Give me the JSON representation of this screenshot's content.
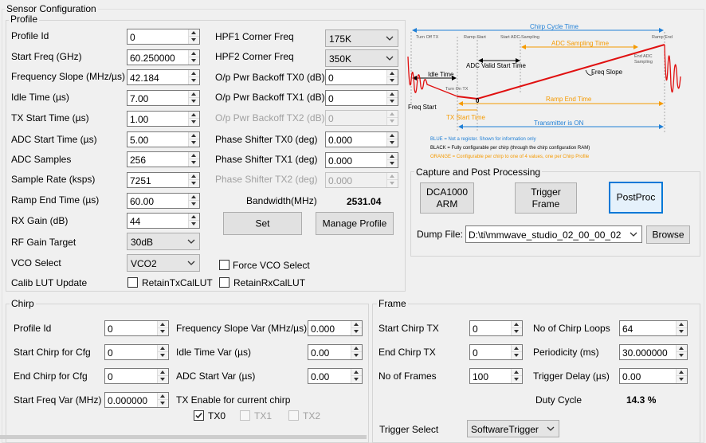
{
  "sensor_config": {
    "title": "Sensor Configuration"
  },
  "profile": {
    "title": "Profile",
    "fields": [
      {
        "label": "Profile Id",
        "value": "0"
      },
      {
        "label": "Start Freq (GHz)",
        "value": "60.250000"
      },
      {
        "label": "Frequency Slope (MHz/µs)",
        "value": "42.184"
      },
      {
        "label": "Idle Time (µs)",
        "value": "7.00"
      },
      {
        "label": "TX Start Time (µs)",
        "value": "1.00"
      },
      {
        "label": "ADC Start Time (µs)",
        "value": "5.00"
      },
      {
        "label": "ADC Samples",
        "value": "256"
      },
      {
        "label": "Sample Rate (ksps)",
        "value": "7251"
      },
      {
        "label": "Ramp End Time (µs)",
        "value": "60.00"
      },
      {
        "label": "RX Gain (dB)",
        "value": "44"
      }
    ],
    "rf_gain_target": {
      "label": "RF Gain Target",
      "value": "30dB"
    },
    "vco_select": {
      "label": "VCO Select",
      "value": "VCO2"
    },
    "calib_lut": {
      "label": "Calib LUT Update",
      "tx_label": "RetainTxCalLUT",
      "rx_label": "RetainRxCalLUT"
    },
    "hpf1": {
      "label": "HPF1 Corner Freq",
      "value": "175K"
    },
    "hpf2": {
      "label": "HPF2 Corner Freq",
      "value": "350K"
    },
    "right_fields": [
      {
        "label": "O/p Pwr Backoff TX0 (dB)",
        "value": "0"
      },
      {
        "label": "O/p Pwr Backoff TX1 (dB)",
        "value": "0"
      },
      {
        "label": "O/p Pwr Backoff TX2 (dB)",
        "value": "0"
      },
      {
        "label": "Phase Shifter TX0 (deg)",
        "value": "0.000"
      },
      {
        "label": "Phase Shifter TX1 (deg)",
        "value": "0.000"
      },
      {
        "label": "Phase Shifter TX2 (deg)",
        "value": "0.000"
      }
    ],
    "bandwidth": {
      "label": "Bandwidth(MHz)",
      "value": "2531.04"
    },
    "set_button": "Set",
    "manage_profile_button": "Manage Profile",
    "force_vco": "Force VCO Select"
  },
  "diagram": {
    "chirp_cycle_time": "Chirp Cycle Time",
    "turn_off_tx": "Turn Off TX",
    "ramp_start": "Ramp Start",
    "start_adc_sampling": "Start ADC Sampling",
    "ramp_end": "Ramp End",
    "adc_sampling_time": "ADC Sampling Time",
    "end_adc_sampling": [
      "End ADC",
      "Sampling"
    ],
    "adc_valid_start_time": "ADC Valid Start Time",
    "idle_time": "Idle Time",
    "freq_slope": "Freq Slope",
    "turn_on_tx": "Turn On TX",
    "freq_start": "Freq Start",
    "zero": "0",
    "ramp_end_time": "Ramp End Time",
    "tx_start_time": "TX Start Time",
    "transmitter_on": "Transmitter is ON",
    "legend_blue": "BLUE = Not a register. Shown for information only",
    "legend_black": "BLACK = Fully configurable per chirp (through the chirp configuration RAM)",
    "legend_orange": "ORANGE = Configurable per chirp to one of 4 values, one per Chirp Profile",
    "colors": {
      "blue": "#1f7fd6",
      "orange": "#f59a00",
      "red": "#e01010",
      "black": "#000000"
    }
  },
  "capture": {
    "title": "Capture and Post Processing",
    "dca_button": [
      "DCA1000",
      "ARM"
    ],
    "trigger_frame_button": [
      "Trigger",
      "Frame"
    ],
    "postproc_button": "PostProc",
    "dump_file_label": "Dump File:",
    "dump_file_value": "D:\\ti\\mmwave_studio_02_00_00_02",
    "browse_button": "Browse"
  },
  "chirp": {
    "title": "Chirp",
    "left_fields": [
      {
        "label": "Profile Id",
        "value": "0"
      },
      {
        "label": "Start Chirp for Cfg",
        "value": "0"
      },
      {
        "label": "End Chirp for Cfg",
        "value": "0"
      },
      {
        "label": "Start Freq Var (MHz)",
        "value": "0.000000"
      }
    ],
    "right_fields": [
      {
        "label": "Frequency Slope Var (MHz/µs)",
        "value": "0.000"
      },
      {
        "label": "Idle Time Var (µs)",
        "value": "0.00"
      },
      {
        "label": "ADC Start Var (µs)",
        "value": "0.00"
      }
    ],
    "tx_enable_label": "TX Enable for current chirp",
    "tx": [
      {
        "label": "TX0",
        "checked": true,
        "enabled": true
      },
      {
        "label": "TX1",
        "checked": false,
        "enabled": false
      },
      {
        "label": "TX2",
        "checked": false,
        "enabled": false
      }
    ]
  },
  "frame": {
    "title": "Frame",
    "left_fields": [
      {
        "label": "Start Chirp TX",
        "value": "0"
      },
      {
        "label": "End Chirp TX",
        "value": "0"
      },
      {
        "label": "No of Frames",
        "value": "100"
      }
    ],
    "right_fields": [
      {
        "label": "No of Chirp Loops",
        "value": "64"
      },
      {
        "label": "Periodicity (ms)",
        "value": "30.000000"
      },
      {
        "label": "Trigger Delay (µs)",
        "value": "0.00"
      }
    ],
    "duty_cycle": {
      "label": "Duty Cycle",
      "value": "14.3 %"
    },
    "trigger_select": {
      "label": "Trigger Select",
      "value": "SoftwareTrigger"
    }
  }
}
